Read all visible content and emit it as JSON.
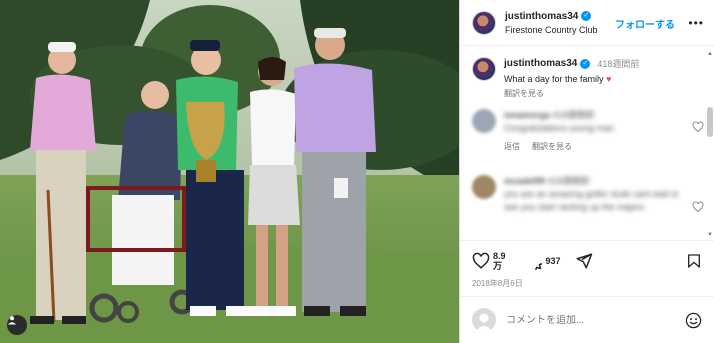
{
  "post": {
    "username": "justinthomas34",
    "location": "Firestone Country Club",
    "follow_label": "フォローする",
    "more_label": "•••"
  },
  "caption": {
    "username": "justinthomas34",
    "time": "418週間前",
    "text": "What a day for the family",
    "heart": "♥",
    "translate_label": "翻訳を見る"
  },
  "comments": [
    {
      "username": "mnamorga",
      "time": "418週間前",
      "text": "Congratulations young man",
      "reply_label": "返信",
      "translate_label": "翻訳を見る"
    },
    {
      "username": "mcadel99",
      "time": "418週間前",
      "text": "you are an amazing golfer dude cant wait to see you start racking up the majors"
    }
  ],
  "actions": {
    "likes_top": "8.9",
    "likes_bottom": "万",
    "comments_count": "937",
    "date": "2018年8月6日"
  },
  "add_comment": {
    "placeholder": "コメントを追加..."
  },
  "icons": {
    "verified": "verified-badge-icon",
    "heart": "heart-outline-icon",
    "comment": "comment-bubble-icon",
    "share": "share-paper-plane-icon",
    "bookmark": "bookmark-icon",
    "emoji": "emoji-smile-icon",
    "user_tag": "user-tag-icon"
  },
  "colors": {
    "accent": "#0095f6",
    "heart_emoji": "#ed4956",
    "text": "#262626",
    "muted": "#8e8e8e"
  }
}
